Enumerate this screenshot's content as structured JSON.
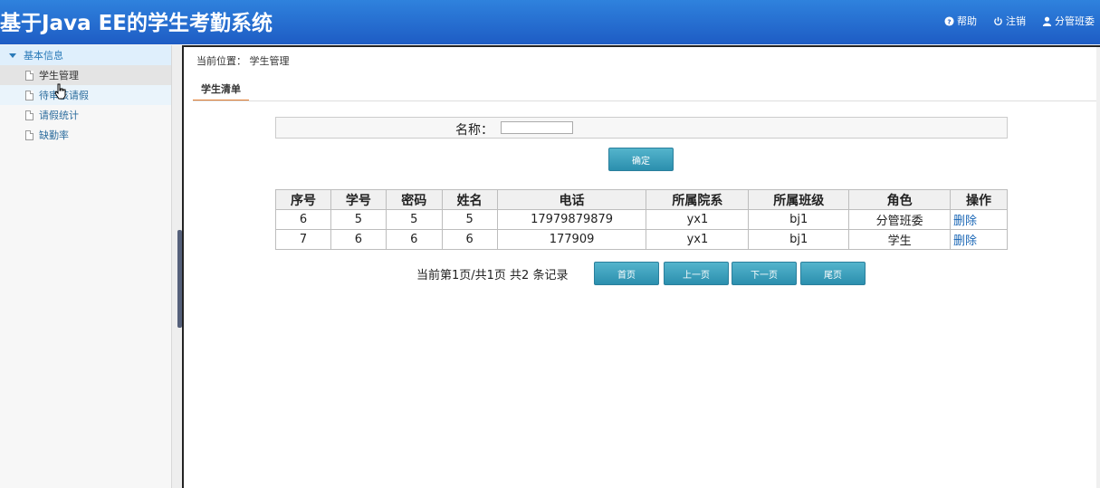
{
  "header": {
    "title": "基于Java EE的学生考勤系统",
    "actions": {
      "help": "帮助",
      "logout": "注销",
      "user": "分管班委"
    }
  },
  "sidebar": {
    "group": "基本信息",
    "items": [
      {
        "label": "学生管理"
      },
      {
        "label": "待审核请假"
      },
      {
        "label": "请假统计"
      },
      {
        "label": "缺勤率"
      }
    ]
  },
  "main": {
    "breadcrumb": "当前位置： 学生管理",
    "tab": "学生清单",
    "search": {
      "label": "名称：",
      "value": "",
      "confirm": "确定"
    },
    "table": {
      "headers": [
        "序号",
        "学号",
        "密码",
        "姓名",
        "电话",
        "所属院系",
        "所属班级",
        "角色",
        "操作"
      ],
      "rows": [
        {
          "id": "6",
          "no": "5",
          "pwd": "5",
          "name": "5",
          "phone": "17979879879",
          "dept": "yx1",
          "cls": "bj1",
          "role": "分管班委",
          "op": "删除"
        },
        {
          "id": "7",
          "no": "6",
          "pwd": "6",
          "name": "6",
          "phone": "177909",
          "dept": "yx1",
          "cls": "bj1",
          "role": "学生",
          "op": "删除"
        }
      ]
    },
    "pager": {
      "text": "当前第1页/共1页  共2 条记录",
      "first": "首页",
      "prev": "上一页",
      "next": "下一页",
      "last": "尾页"
    }
  }
}
